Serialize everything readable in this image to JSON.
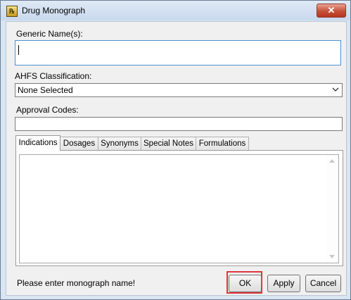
{
  "window": {
    "title": "Drug Monograph",
    "close_glyph": "✕"
  },
  "form": {
    "generic_name_label": "Generic Name(s):",
    "generic_name_value": "",
    "ahfs_label": "AHFS Classification:",
    "ahfs_selected": "None Selected",
    "approval_codes_label": "Approval Codes:",
    "approval_codes_value": ""
  },
  "tabs": [
    {
      "label": "Indications",
      "active": true
    },
    {
      "label": "Dosages",
      "active": false
    },
    {
      "label": "Synonyms",
      "active": false
    },
    {
      "label": "Special Notes",
      "active": false
    },
    {
      "label": "Formulations",
      "active": false
    }
  ],
  "status": {
    "message": "Please enter monograph name!"
  },
  "buttons": {
    "ok": "OK",
    "apply": "Apply",
    "cancel": "Cancel"
  },
  "icons": [
    "app-icon",
    "close-icon",
    "dropdown-chevron-icon",
    "scroll-up-icon",
    "scroll-down-icon"
  ],
  "colors": {
    "highlight": "#e0343c",
    "title_bar": "#dae5f3",
    "focus_border": "#4f8fd0"
  }
}
